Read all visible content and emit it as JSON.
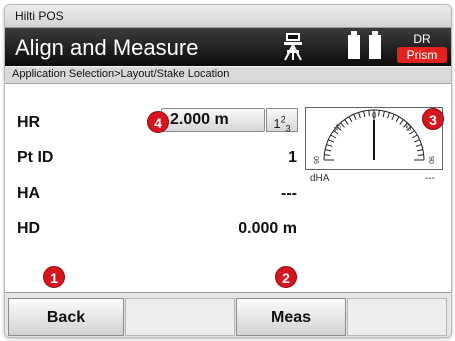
{
  "window": {
    "title": "Hilti POS"
  },
  "header": {
    "title": "Align and Measure",
    "mode": "DR",
    "target": "Prism"
  },
  "breadcrumb": "Application Selection>Layout/Stake Location",
  "fields": {
    "hr": {
      "label": "HR",
      "value": "2.000 m",
      "unit_toggle": "123"
    },
    "ptid": {
      "label": "Pt ID",
      "value": "1"
    },
    "ha": {
      "label": "HA",
      "value": "---"
    },
    "hd": {
      "label": "HD",
      "value": "0.000 m"
    }
  },
  "gauge": {
    "scale_labels": [
      "0",
      "45",
      "45",
      "90",
      "90"
    ],
    "dha_label": "dHA",
    "dha_value": "---"
  },
  "callouts": [
    "1",
    "2",
    "3",
    "4"
  ],
  "softkeys": {
    "back": "Back",
    "meas": "Meas"
  },
  "colors": {
    "header_bg": "#111111",
    "prism_badge": "#e0231f",
    "callout": "#d7151e"
  },
  "icons": [
    "tripod-icon",
    "battery-icon",
    "battery-icon"
  ]
}
